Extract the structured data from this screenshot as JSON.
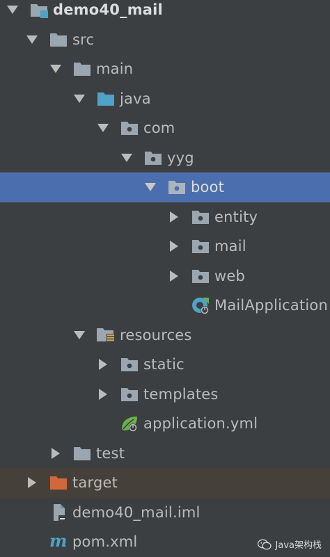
{
  "tree": {
    "project": "demo40_mail",
    "src": "src",
    "main": "main",
    "java": "java",
    "com": "com",
    "yyg": "yyg",
    "boot": "boot",
    "entity": "entity",
    "mail": "mail",
    "web": "web",
    "mail_application": "MailApplication",
    "resources": "resources",
    "static": "static",
    "templates": "templates",
    "application_yml": "application.yml",
    "test": "test",
    "target": "target",
    "iml_file": "demo40_mail.iml",
    "pom_file": "pom.xml"
  },
  "colors": {
    "background": "#3c3f41",
    "selection": "#4b6eaf",
    "excluded_row": "#45403a",
    "folder": "#9aa7b0",
    "source_folder": "#4ea3c6",
    "target_folder": "#d1683b",
    "spring_green": "#6aaf50"
  },
  "icons": {
    "collapse": "chevron-down-icon",
    "expand": "chevron-right-icon",
    "folder": "folder-icon",
    "package": "package-icon",
    "source_root": "source-root-icon",
    "resources_root": "resources-root-icon",
    "excluded_folder": "excluded-folder-icon",
    "spring_boot_class": "spring-boot-class-icon",
    "spring_config": "spring-config-icon",
    "iml": "module-file-icon",
    "maven": "maven-icon"
  },
  "watermark": "Java架构栈"
}
